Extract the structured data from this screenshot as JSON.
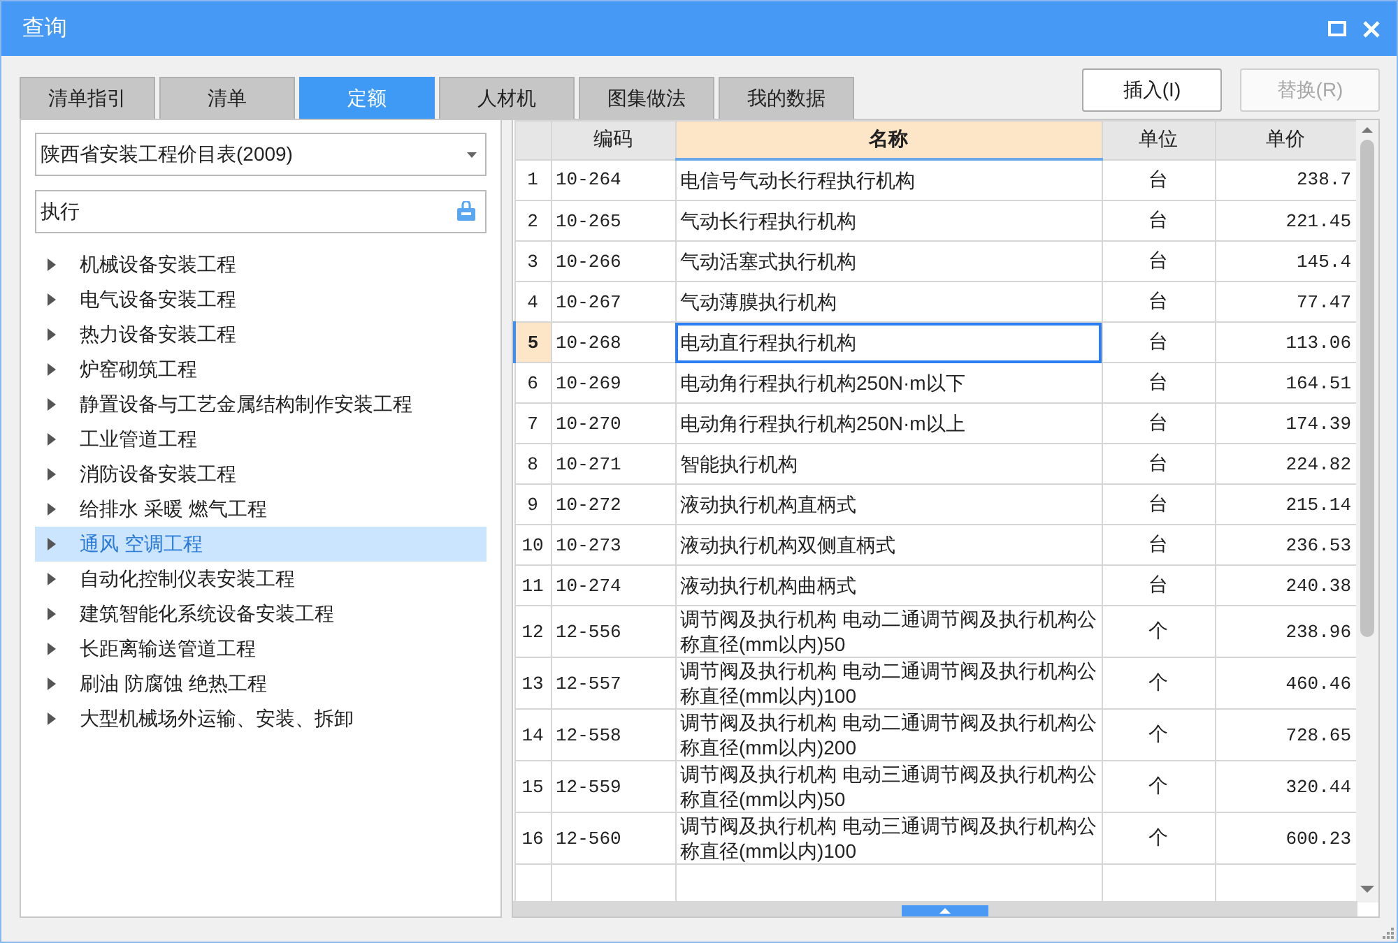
{
  "window": {
    "title": "查询"
  },
  "tabs": [
    {
      "label": "清单指引",
      "selected": false
    },
    {
      "label": "清单",
      "selected": false
    },
    {
      "label": "定额",
      "selected": true
    },
    {
      "label": "人材机",
      "selected": false
    },
    {
      "label": "图集做法",
      "selected": false
    },
    {
      "label": "我的数据",
      "selected": false
    }
  ],
  "buttons": [
    {
      "label": "插入(I)",
      "disabled": false
    },
    {
      "label": "替换(R)",
      "disabled": true
    }
  ],
  "library": {
    "value": "陕西省安装工程价目表(2009)"
  },
  "search": {
    "value": "执行"
  },
  "tree": [
    {
      "label": "机械设备安装工程",
      "expanded": false,
      "selected": false
    },
    {
      "label": "电气设备安装工程",
      "expanded": false,
      "selected": false
    },
    {
      "label": "热力设备安装工程",
      "expanded": false,
      "selected": false
    },
    {
      "label": "炉窑砌筑工程",
      "expanded": false,
      "selected": false
    },
    {
      "label": "静置设备与工艺金属结构制作安装工程",
      "expanded": false,
      "selected": false
    },
    {
      "label": "工业管道工程",
      "expanded": false,
      "selected": false
    },
    {
      "label": "消防设备安装工程",
      "expanded": false,
      "selected": false
    },
    {
      "label": "给排水 采暖 燃气工程",
      "expanded": false,
      "selected": false
    },
    {
      "label": "通风 空调工程",
      "expanded": false,
      "selected": true
    },
    {
      "label": "自动化控制仪表安装工程",
      "expanded": false,
      "selected": false
    },
    {
      "label": "建筑智能化系统设备安装工程",
      "expanded": false,
      "selected": false
    },
    {
      "label": "长距离输送管道工程",
      "expanded": false,
      "selected": false
    },
    {
      "label": "刷油 防腐蚀 绝热工程",
      "expanded": false,
      "selected": false
    },
    {
      "label": "大型机械场外运输、安装、拆卸",
      "expanded": false,
      "selected": false
    }
  ],
  "table": {
    "columns": [
      {
        "label": "编码",
        "selected": false
      },
      {
        "label": "名称",
        "selected": true
      },
      {
        "label": "单位",
        "selected": false
      },
      {
        "label": "单价",
        "selected": false
      }
    ],
    "rows": [
      {
        "number": "1",
        "code": "10-264",
        "name": "电信号气动长行程执行机构",
        "unit": "台",
        "price": "238.7",
        "selected": false
      },
      {
        "number": "2",
        "code": "10-265",
        "name": "气动长行程执行机构",
        "unit": "台",
        "price": "221.45",
        "selected": false
      },
      {
        "number": "3",
        "code": "10-266",
        "name": "气动活塞式执行机构",
        "unit": "台",
        "price": "145.4",
        "selected": false
      },
      {
        "number": "4",
        "code": "10-267",
        "name": "气动薄膜执行机构",
        "unit": "台",
        "price": "77.47",
        "selected": false
      },
      {
        "number": "5",
        "code": "10-268",
        "name": "电动直行程执行机构",
        "unit": "台",
        "price": "113.06",
        "selected": true
      },
      {
        "number": "6",
        "code": "10-269",
        "name": "电动角行程执行机构250N·m以下",
        "unit": "台",
        "price": "164.51",
        "selected": false
      },
      {
        "number": "7",
        "code": "10-270",
        "name": "电动角行程执行机构250N·m以上",
        "unit": "台",
        "price": "174.39",
        "selected": false
      },
      {
        "number": "8",
        "code": "10-271",
        "name": "智能执行机构",
        "unit": "台",
        "price": "224.82",
        "selected": false
      },
      {
        "number": "9",
        "code": "10-272",
        "name": "液动执行机构直柄式",
        "unit": "台",
        "price": "215.14",
        "selected": false
      },
      {
        "number": "10",
        "code": "10-273",
        "name": "液动执行机构双侧直柄式",
        "unit": "台",
        "price": "236.53",
        "selected": false
      },
      {
        "number": "11",
        "code": "10-274",
        "name": "液动执行机构曲柄式",
        "unit": "台",
        "price": "240.38",
        "selected": false
      },
      {
        "number": "12",
        "code": "12-556",
        "name": "调节阀及执行机构 电动二通调节阀及执行机构公称直径(mm以内)50",
        "unit": "个",
        "price": "238.96",
        "selected": false
      },
      {
        "number": "13",
        "code": "12-557",
        "name": "调节阀及执行机构 电动二通调节阀及执行机构公称直径(mm以内)100",
        "unit": "个",
        "price": "460.46",
        "selected": false
      },
      {
        "number": "14",
        "code": "12-558",
        "name": "调节阀及执行机构 电动二通调节阀及执行机构公称直径(mm以内)200",
        "unit": "个",
        "price": "728.65",
        "selected": false
      },
      {
        "number": "15",
        "code": "12-559",
        "name": "调节阀及执行机构 电动三通调节阀及执行机构公称直径(mm以内)50",
        "unit": "个",
        "price": "320.44",
        "selected": false
      },
      {
        "number": "16",
        "code": "12-560",
        "name": "调节阀及执行机构 电动三通调节阀及执行机构公称直径(mm以内)100",
        "unit": "个",
        "price": "600.23",
        "selected": false
      }
    ]
  }
}
